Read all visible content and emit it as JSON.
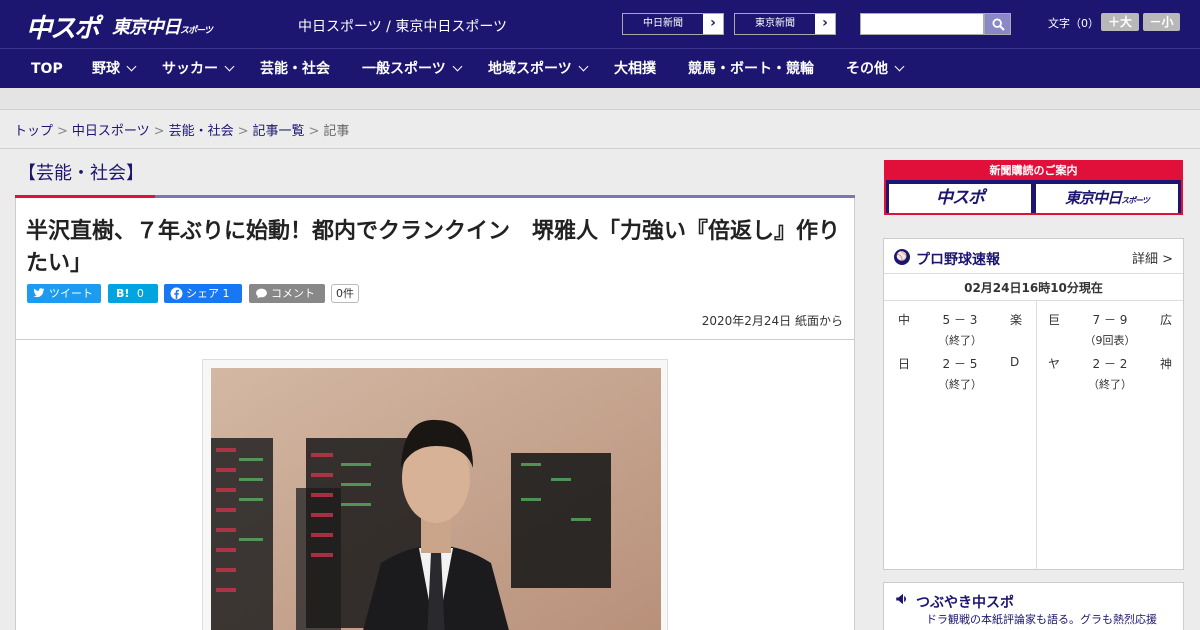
{
  "header": {
    "logo_main": "中スポ",
    "logo_sub": "東京中日",
    "logo_sub_small": "スポーツ",
    "site_names": "中日スポーツ / 東京中日スポーツ",
    "ext_links": [
      {
        "label": "中日新聞",
        "arrow": "›"
      },
      {
        "label": "東京新聞",
        "arrow": "›"
      }
    ],
    "search_placeholder": "",
    "font_size_label": "文字（0）",
    "font_up": "＋大",
    "font_down": "－小"
  },
  "nav": {
    "items": [
      {
        "label": "TOP",
        "dropdown": false
      },
      {
        "label": "野球",
        "dropdown": true
      },
      {
        "label": "サッカー",
        "dropdown": true
      },
      {
        "label": "芸能・社会",
        "dropdown": false
      },
      {
        "label": "一般スポーツ",
        "dropdown": true
      },
      {
        "label": "地域スポーツ",
        "dropdown": true
      },
      {
        "label": "大相撲",
        "dropdown": false
      },
      {
        "label": "競馬・ボート・競輪",
        "dropdown": false
      },
      {
        "label": "その他",
        "dropdown": true
      }
    ]
  },
  "breadcrumb": {
    "items": [
      "トップ",
      "中日スポーツ",
      "芸能・社会",
      "記事一覧",
      "記事"
    ],
    "separator": ">"
  },
  "article": {
    "category": "【芸能・社会】",
    "headline": "半沢直樹、７年ぶりに始動！都内でクランクイン　堺雅人「力強い『倍返し』作りたい」",
    "share": {
      "tweet": "ツイート",
      "hatena_icon": "B!",
      "hatena_count": "0",
      "facebook": "シェア",
      "facebook_count": "1",
      "comment": "コメント",
      "comment_count": "0件"
    },
    "date": "2020年2月24日 紙面から"
  },
  "sidebar": {
    "subscription_title": "新聞購読のご案内",
    "subscription_buttons": [
      "中スポ",
      "東京中日"
    ],
    "subscription_button_small": "スポーツ",
    "score_title": "プロ野球速報",
    "score_icon": "⚾",
    "score_more": "詳細 >",
    "score_time": "02月24日16時10分現在",
    "games_left": [
      {
        "home": "中",
        "score": "5 － 3",
        "away": "楽",
        "status": "（終了）"
      },
      {
        "home": "日",
        "score": "2 － 5",
        "away": "D",
        "status": "（終了）"
      }
    ],
    "games_right": [
      {
        "home": "巨",
        "score": "7 － 9",
        "away": "広",
        "status": "（9回表）"
      },
      {
        "home": "ヤ",
        "score": "2 － 2",
        "away": "神",
        "status": "（終了）"
      }
    ],
    "tweet_title": "つぶやき中スポ",
    "tweet_sub": "ドラ観戦の本紙評論家も語る。グラも熱烈応援"
  },
  "colors": {
    "brand_navy": "#1c1670",
    "accent_red": "#e0103a",
    "twitter": "#1d9bf0",
    "hatena": "#00a4de",
    "facebook": "#1877f2"
  }
}
